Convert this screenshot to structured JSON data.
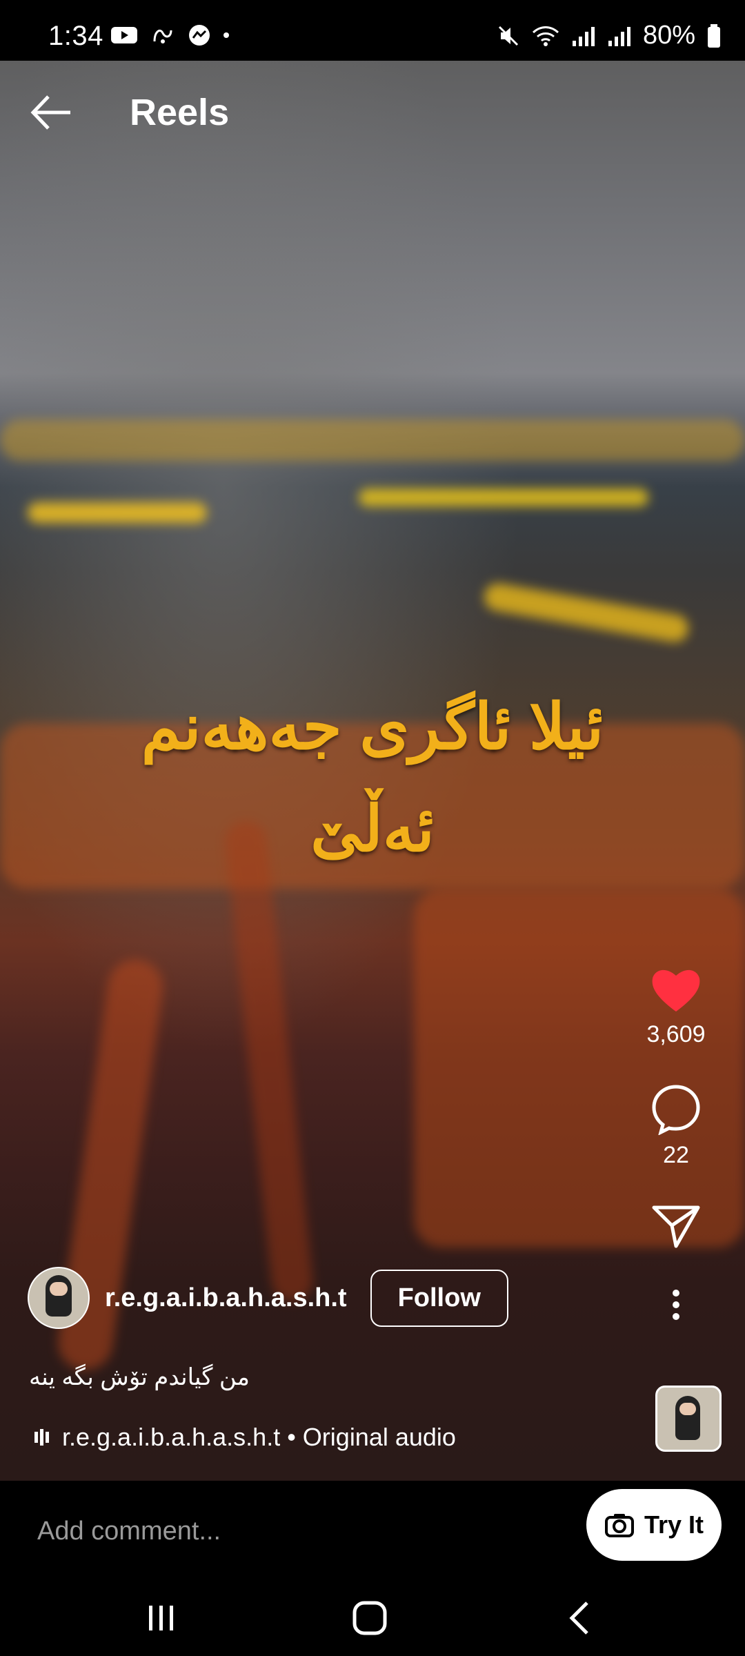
{
  "status": {
    "time": "1:34",
    "battery": "80%"
  },
  "header": {
    "title": "Reels"
  },
  "overlay": {
    "line1": "ئیلا ئاگری جەهەنم",
    "line2": "ئەڵێ"
  },
  "actions": {
    "likes": "3,609",
    "comments": "22"
  },
  "user": {
    "username": "r.e.g.a.i.b.a.h.a.s.h.t",
    "follow_label": "Follow"
  },
  "caption": "من گیاندم تۆش بگە ینە",
  "audio": {
    "text": "r.e.g.a.i.b.a.h.a.s.h.t • Original audio"
  },
  "comment": {
    "placeholder": "Add comment...",
    "try_label": "Try It"
  },
  "colors": {
    "like": "#ff3040",
    "overlay_text": "#f2b01a"
  }
}
